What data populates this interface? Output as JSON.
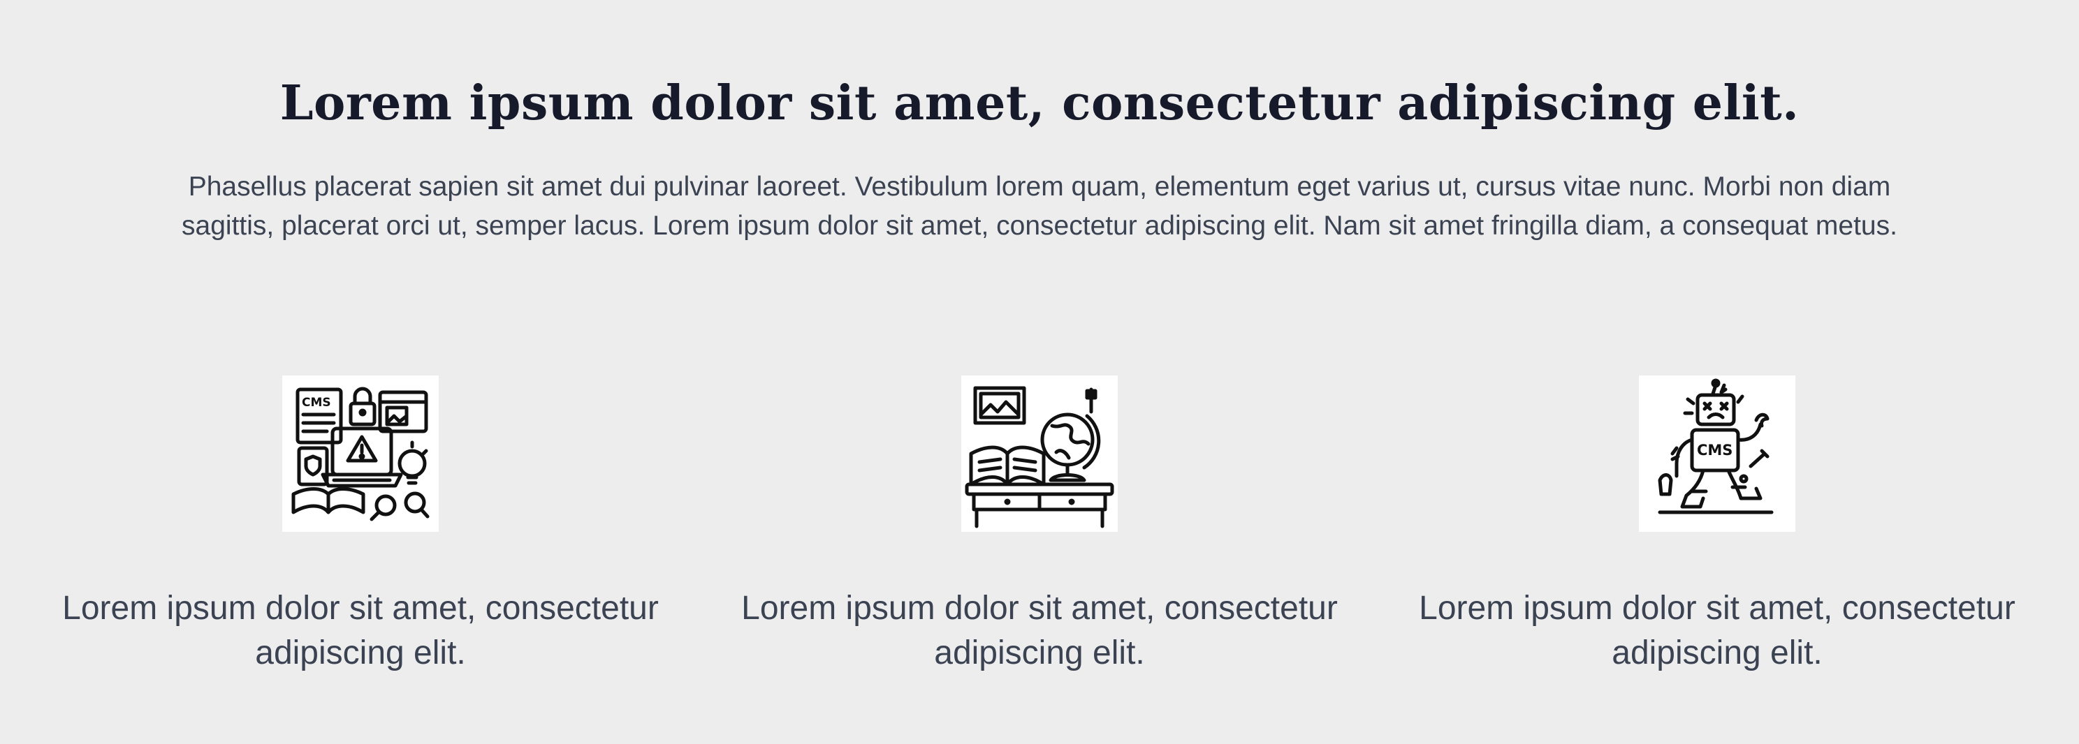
{
  "section": {
    "headline": "Lorem ipsum dolor sit amet, consectetur adipiscing elit.",
    "intro": "Phasellus placerat sapien sit amet dui pulvinar laoreet. Vestibulum lorem quam, elementum eget varius ut, cursus vitae nunc. Morbi non diam sagittis, placerat orci ut, semper lacus. Lorem ipsum dolor sit amet, consectetur adipiscing elit. Nam sit amet fringilla diam, a consequat metus."
  },
  "features": [
    {
      "icon": "cms-workspace-warning-illustration",
      "text": "Lorem ipsum dolor sit amet, consectetur adipiscing elit.",
      "icon_label": "CMS"
    },
    {
      "icon": "desk-book-globe-illustration",
      "text": "Lorem ipsum dolor sit amet, consectetur adipiscing elit."
    },
    {
      "icon": "broken-cms-robot-illustration",
      "text": "Lorem ipsum dolor sit amet, consectetur adipiscing elit.",
      "icon_label": "CMS"
    }
  ],
  "colors": {
    "background": "#ededed",
    "heading": "#161a2b",
    "body_text": "#3b4353",
    "icon_background": "#ffffff",
    "icon_stroke": "#111111"
  }
}
